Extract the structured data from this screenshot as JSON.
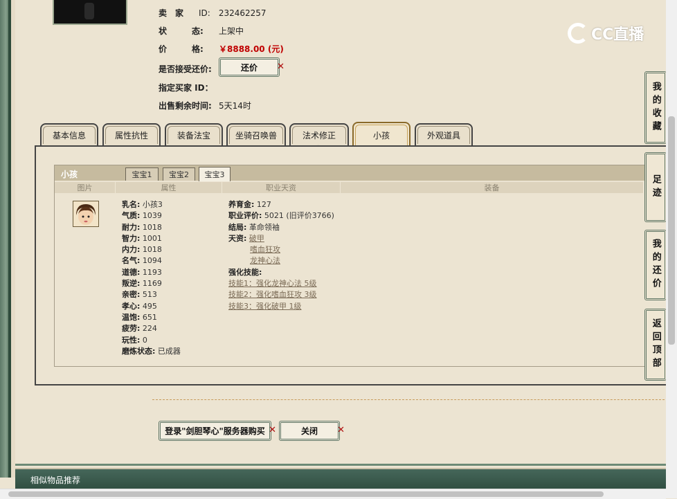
{
  "seller": {
    "seller_label": "卖　家",
    "seller_value": "ID:　232462257",
    "status_label": "状　　　态:",
    "status_value": "上架中",
    "price_label": "价　　　格:",
    "price_value": "￥8888.00 (元)",
    "bargain_label": "是否接受还价:",
    "bargain_button": "还价",
    "buyer_label": "指定买家 ID：",
    "time_label": "出售剩余时间:",
    "time_value": "5天14时"
  },
  "tabs": [
    "基本信息",
    "属性抗性",
    "装备法宝",
    "坐骑召唤兽",
    "法术修正",
    "小孩",
    "外观道具"
  ],
  "active_tab": "小孩",
  "child_panel": {
    "title": "小孩",
    "subtabs": [
      "宝宝1",
      "宝宝2",
      "宝宝3"
    ],
    "active_subtab": "宝宝3",
    "columns": [
      "图片",
      "属性",
      "职业天资",
      "装备"
    ],
    "attributes": [
      {
        "label": "乳名:",
        "value": "小孩3"
      },
      {
        "label": "气质:",
        "value": "1039"
      },
      {
        "label": "耐力:",
        "value": "1018"
      },
      {
        "label": "智力:",
        "value": "1001"
      },
      {
        "label": "内力:",
        "value": "1018"
      },
      {
        "label": "名气:",
        "value": "1094"
      },
      {
        "label": "道德:",
        "value": "1193"
      },
      {
        "label": "叛逆:",
        "value": "1169"
      },
      {
        "label": "亲密:",
        "value": "513"
      },
      {
        "label": "孝心:",
        "value": "495"
      },
      {
        "label": "温饱:",
        "value": "651"
      },
      {
        "label": "疲劳:",
        "value": "224"
      },
      {
        "label": "玩性:",
        "value": "0"
      },
      {
        "label": "磨炼状态:",
        "value": "已成器"
      }
    ],
    "career": {
      "raising_label": "养育金:",
      "raising_value": "127",
      "eval_label": "职业评价:",
      "eval_value": "5021 (旧评价3766)",
      "ending_label": "结局:",
      "ending_value": "革命领袖",
      "talent_label": "天资:",
      "talents": [
        "破甲",
        "嗜血狂攻",
        "龙神心法"
      ],
      "skills_label": "强化技能:",
      "skills": [
        "技能1：强化龙神心法 5级",
        "技能2：强化嗜血狂攻 3级",
        "技能3：强化破甲 1级"
      ]
    }
  },
  "bottom_buttons": {
    "login_buy": "登录\"剑胆琴心\"服务器购买",
    "close": "关闭"
  },
  "side_nav": [
    "我的收藏",
    "足迹",
    "我的还价",
    "返回顶部"
  ],
  "footer_title": "相似物品推荐",
  "watermark": "CC直播"
}
